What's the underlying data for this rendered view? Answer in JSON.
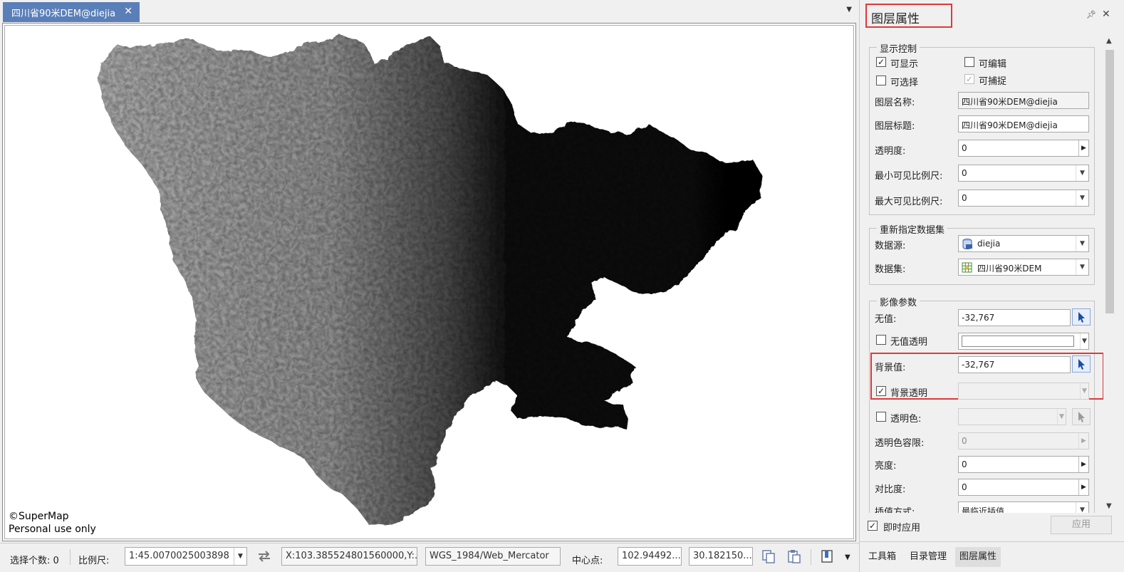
{
  "document_tab": {
    "title": "四川省90米DEM@diejia",
    "close_glyph": "✕"
  },
  "map": {
    "copyright_line1": "©SuperMap",
    "copyright_line2": "Personal use only"
  },
  "statusbar": {
    "selected_count_label": "选择个数: 0",
    "scale_label": "比例尺:",
    "scale_value": "1:45.0070025003898",
    "coords_value": "X:103.385524801560000,Y:...",
    "projection": "WGS_1984/Web_Mercator",
    "center_label": "中心点:",
    "center_x": "102.94492...",
    "center_y": "30.182150..."
  },
  "panel": {
    "title": "图层属性",
    "display_group": {
      "legend": "显示控制",
      "visible_label": "可显示",
      "visible_checked": true,
      "editable_label": "可编辑",
      "editable_checked": false,
      "selectable_label": "可选择",
      "selectable_checked": false,
      "snappable_label": "可捕捉",
      "snappable_checked": true,
      "layer_name_label": "图层名称:",
      "layer_name_value": "四川省90米DEM@diejia",
      "layer_caption_label": "图层标题:",
      "layer_caption_value": "四川省90米DEM@diejia",
      "transparency_label": "透明度:",
      "transparency_value": "0",
      "min_scale_label": "最小可见比例尺:",
      "min_scale_value": "0",
      "max_scale_label": "最大可见比例尺:",
      "max_scale_value": "0"
    },
    "dataset_group": {
      "legend": "重新指定数据集",
      "datasource_label": "数据源:",
      "datasource_value": "diejia",
      "dataset_label": "数据集:",
      "dataset_value": "四川省90米DEM"
    },
    "image_group": {
      "legend": "影像参数",
      "nodata_label": "无值:",
      "nodata_value": "-32,767",
      "nodata_transparent_label": "无值透明",
      "nodata_transparent_checked": false,
      "background_label": "背景值:",
      "background_value": "-32,767",
      "background_transparent_label": "背景透明",
      "background_transparent_checked": true,
      "transparent_color_label": "透明色:",
      "transparent_color_checked": false,
      "transparent_tolerance_label": "透明色容限:",
      "transparent_tolerance_value": "0",
      "brightness_label": "亮度:",
      "brightness_value": "0",
      "contrast_label": "对比度:",
      "contrast_value": "0",
      "interpolation_label": "插值方式:",
      "interpolation_value": "最临近插值"
    },
    "instant_apply_label": "即时应用",
    "instant_apply_checked": true,
    "apply_button": "应用"
  },
  "bottom_tabs": [
    {
      "label": "工具箱",
      "active": false
    },
    {
      "label": "目录管理",
      "active": false
    },
    {
      "label": "图层属性",
      "active": true
    }
  ],
  "colors": {
    "accent_tab": "#5a7fb8",
    "highlight_red": "#e0383a"
  },
  "icons": [
    "close-icon",
    "dropdown-arrow-icon",
    "swap-icon",
    "copy-icon",
    "paste-icon",
    "bookmark-icon",
    "pin-icon",
    "datasource-icon",
    "grid-dataset-icon",
    "picker-icon"
  ]
}
